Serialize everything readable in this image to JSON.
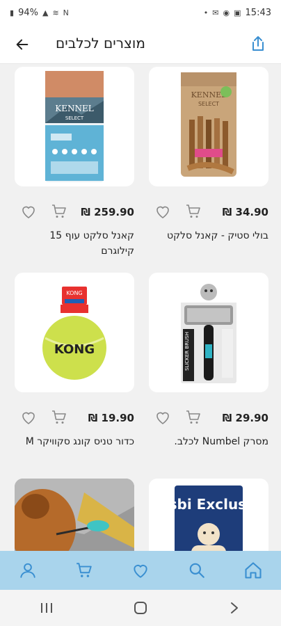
{
  "status_bar": {
    "battery": "94%",
    "time": "15:43"
  },
  "header": {
    "title": "מוצרים לכלבים",
    "back_icon": "arrow-left-icon",
    "share_icon": "share-icon"
  },
  "products": [
    {
      "name": "בולי סטיק - קאנל סלקט",
      "price": "34.90 ₪",
      "image": "bully-stick-bag"
    },
    {
      "name": "קאנל סלקט עוף 15 קילוגרם",
      "price": "259.90 ₪",
      "image": "kanel-select-bag"
    },
    {
      "name": "מסרק Numbel לכלב.",
      "price": "29.90 ₪",
      "image": "slicker-brush"
    },
    {
      "name": "כדור טניס קונג סקוויקר M",
      "price": "19.90 ₪",
      "image": "kong-tennis-ball"
    },
    {
      "name": "Gosbi Exclusive",
      "price": "",
      "image": "gosbi-bag"
    },
    {
      "name": "",
      "price": "",
      "image": "dog-toy-photo"
    }
  ],
  "bottom_nav": {
    "items": [
      "home-icon",
      "search-icon",
      "heart-icon",
      "cart-icon",
      "user-icon"
    ]
  },
  "colors": {
    "bottom_nav_bg": "#a9d4ec",
    "accent": "#3a8fd1"
  }
}
